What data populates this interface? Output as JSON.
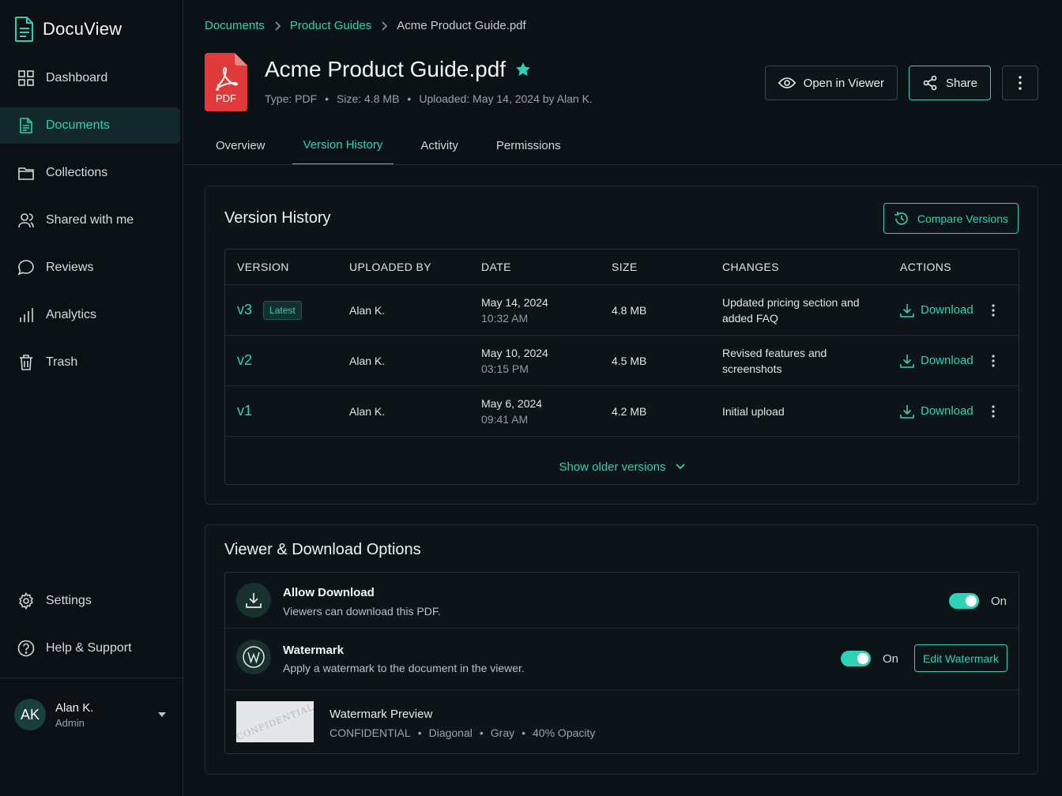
{
  "app": {
    "name": "DocuView"
  },
  "sidebar": {
    "items": [
      {
        "label": "Dashboard",
        "icon": "grid-icon"
      },
      {
        "label": "Documents",
        "icon": "document-icon",
        "active": true
      },
      {
        "label": "Collections",
        "icon": "folder-icon"
      },
      {
        "label": "Shared with me",
        "icon": "users-icon"
      },
      {
        "label": "Reviews",
        "icon": "chat-icon"
      },
      {
        "label": "Analytics",
        "icon": "bar-chart-icon"
      },
      {
        "label": "Trash",
        "icon": "trash-icon"
      }
    ],
    "bottom": [
      {
        "label": "Settings",
        "icon": "gear-icon"
      },
      {
        "label": "Help & Support",
        "icon": "help-icon"
      }
    ],
    "user": {
      "initials": "AK",
      "name": "Alan K.",
      "role": "Admin"
    }
  },
  "breadcrumb": [
    "Documents",
    "Product Guides",
    "Acme Product Guide.pdf"
  ],
  "file": {
    "badge": "PDF",
    "title": "Acme Product Guide.pdf",
    "type": "Type: PDF",
    "size": "Size: 4.8 MB",
    "uploaded": "Uploaded: May 14, 2024 by Alan K."
  },
  "actions": {
    "open": "Open in Viewer",
    "share": "Share"
  },
  "tabs": [
    "Overview",
    "Version History",
    "Activity",
    "Permissions"
  ],
  "version_history": {
    "title": "Version History",
    "compare": "Compare Versions",
    "columns": [
      "VERSION",
      "UPLOADED BY",
      "DATE",
      "SIZE",
      "CHANGES",
      "ACTIONS"
    ],
    "rows": [
      {
        "version": "v3",
        "badge": "Latest",
        "by": "Alan K.",
        "date": "May 14, 2024",
        "time": "10:32 AM",
        "size": "4.8 MB",
        "changes": "Updated pricing section and added FAQ",
        "action": "Download"
      },
      {
        "version": "v2",
        "badge": "",
        "by": "Alan K.",
        "date": "May 10, 2024",
        "time": "03:15 PM",
        "size": "4.5 MB",
        "changes": "Revised features and screenshots",
        "action": "Download"
      },
      {
        "version": "v1",
        "badge": "",
        "by": "Alan K.",
        "date": "May 6, 2024",
        "time": "09:41 AM",
        "size": "4.2 MB",
        "changes": "Initial upload",
        "action": "Download"
      }
    ],
    "show_older": "Show older versions"
  },
  "options": {
    "title": "Viewer & Download Options",
    "allow_download": {
      "title": "Allow Download",
      "desc": "Viewers can download this PDF.",
      "state": "On"
    },
    "watermark": {
      "title": "Watermark",
      "desc": "Apply a watermark to the document in the viewer.",
      "state": "On",
      "edit": "Edit Watermark"
    },
    "preview": {
      "title": "Watermark Preview",
      "text": "CONFIDENTIAL",
      "style": "Diagonal",
      "color": "Gray",
      "opacity": "40% Opacity"
    }
  },
  "colors": {
    "accent": "#2ed3b7",
    "background": "#0b1215",
    "pdf_red": "#e03a3a"
  }
}
